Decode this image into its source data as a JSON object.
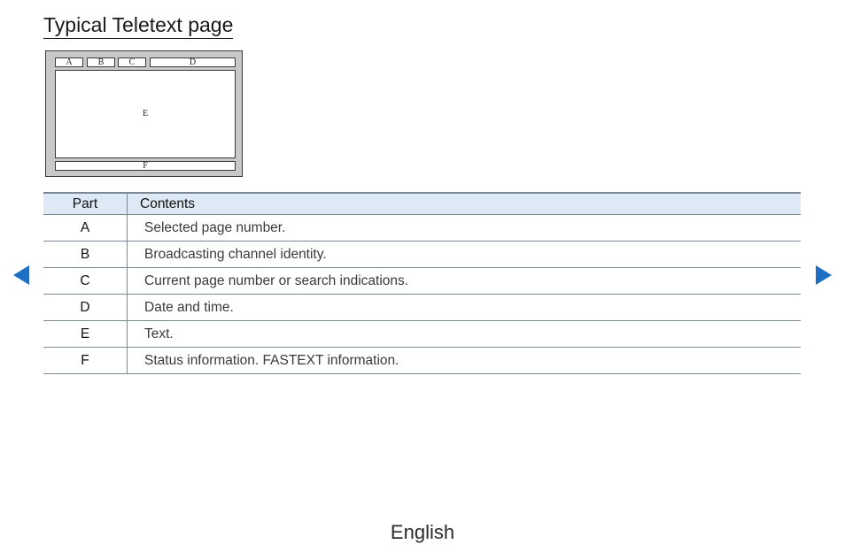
{
  "page": {
    "title": "Typical Teletext page"
  },
  "diagram": {
    "labels": {
      "a": "A",
      "b": "B",
      "c": "C",
      "d": "D",
      "e": "E",
      "f": "F"
    }
  },
  "table": {
    "headers": {
      "part": "Part",
      "contents": "Contents"
    },
    "rows": [
      {
        "part": "A",
        "contents": "Selected page number."
      },
      {
        "part": "B",
        "contents": "Broadcasting channel identity."
      },
      {
        "part": "C",
        "contents": "Current page number or search indications."
      },
      {
        "part": "D",
        "contents": "Date and time."
      },
      {
        "part": "E",
        "contents": "Text."
      },
      {
        "part": "F",
        "contents": "Status information. FASTEXT information."
      }
    ]
  },
  "navigation": {
    "prev_icon": "triangle-left-icon",
    "next_icon": "triangle-right-icon",
    "accent_color": "#1e6fc4"
  },
  "footer": {
    "language": "English"
  }
}
